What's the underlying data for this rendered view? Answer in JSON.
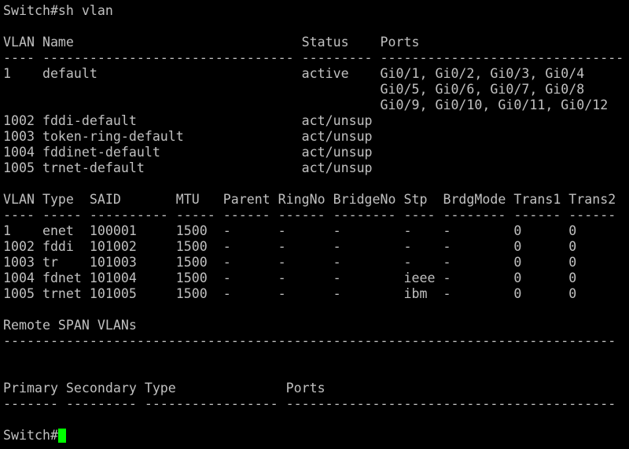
{
  "terminal": {
    "cursor_color": "#00ff00",
    "text_color": "#c0c0c0",
    "background": "#000000",
    "lines": [
      "Switch#sh vlan",
      "",
      "VLAN Name                             Status    Ports",
      "---- -------------------------------- --------- -------------------------------",
      "1    default                          active    Gi0/1, Gi0/2, Gi0/3, Gi0/4",
      "                                                Gi0/5, Gi0/6, Gi0/7, Gi0/8",
      "                                                Gi0/9, Gi0/10, Gi0/11, Gi0/12",
      "1002 fddi-default                     act/unsup",
      "1003 token-ring-default               act/unsup",
      "1004 fddinet-default                  act/unsup",
      "1005 trnet-default                    act/unsup",
      "",
      "VLAN Type  SAID       MTU   Parent RingNo BridgeNo Stp  BrdgMode Trans1 Trans2",
      "---- ----- ---------- ----- ------ ------ -------- ---- -------- ------ ------",
      "1    enet  100001     1500  -      -      -        -    -        0      0",
      "1002 fddi  101002     1500  -      -      -        -    -        0      0",
      "1003 tr    101003     1500  -      -      -        -    -        0      0",
      "1004 fdnet 101004     1500  -      -      -        ieee -        0      0",
      "1005 trnet 101005     1500  -      -      -        ibm  -        0      0",
      "",
      "Remote SPAN VLANs",
      "------------------------------------------------------------------------------",
      "",
      "",
      "Primary Secondary Type              Ports",
      "------- --------- ----------------- ------------------------------------------",
      ""
    ],
    "prompt": "Switch#"
  }
}
